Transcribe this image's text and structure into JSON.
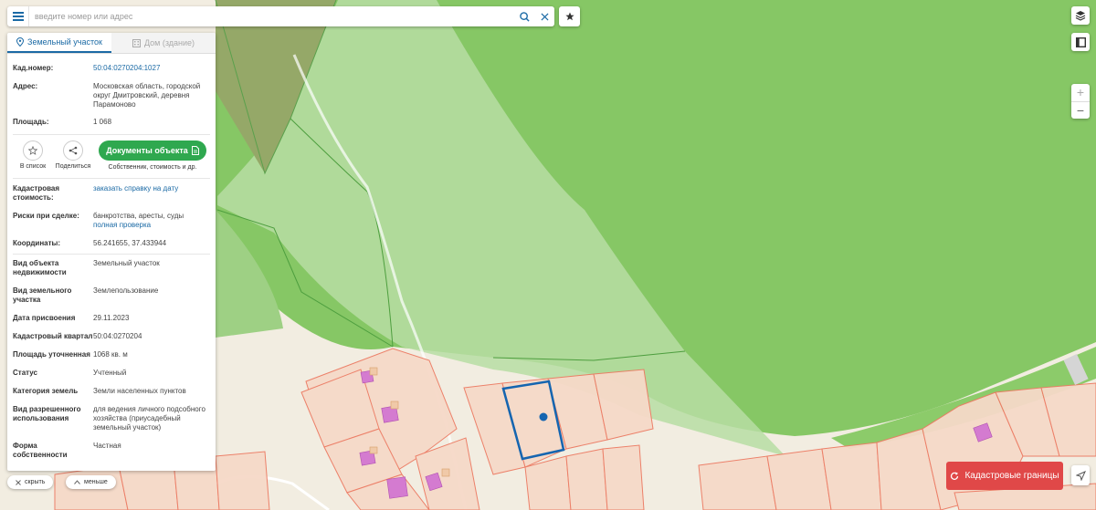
{
  "search": {
    "placeholder": "введите номер или адрес"
  },
  "tabs": [
    {
      "label": "Земельный участок",
      "active": true
    },
    {
      "label": "Дом (здание)",
      "active": false
    }
  ],
  "info": {
    "cad_number_label": "Кад.номер:",
    "cad_number": "50:04:0270204:1027",
    "address_label": "Адрес:",
    "address": "Московская область, городской округ Дмитровский, деревня Парамоново",
    "area_label": "Площадь:",
    "area": "1 068"
  },
  "actions": {
    "favorite_label": "В список",
    "share_label": "Поделиться",
    "docs_label": "Документы объекта",
    "docs_sub": "Собственник, стоимость и др."
  },
  "details": [
    {
      "label": "Кадастровая стоимость:",
      "value": "заказать справку на дату",
      "link": true
    },
    {
      "label": "Риски при сделке:",
      "value": "банкротства, аресты, суды",
      "extra_link": "полная проверка"
    },
    {
      "label": "Координаты:",
      "value": "56.241655, 37.433944"
    },
    {
      "label": "Вид объекта недвижимости",
      "value": "Земельный участок"
    },
    {
      "label": "Вид земельного участка",
      "value": "Землепользование"
    },
    {
      "label": "Дата присвоения",
      "value": "29.11.2023"
    },
    {
      "label": "Кадастровый квартал",
      "value": "50:04:0270204"
    },
    {
      "label": "Площадь уточненная",
      "value": "1068 кв. м"
    },
    {
      "label": "Статус",
      "value": "Учтенный"
    },
    {
      "label": "Категория земель",
      "value": "Земли населенных пунктов"
    },
    {
      "label": "Вид разрешенного использования",
      "value": "для ведения личного подсобного хозяйства (приусадебный земельный участок)"
    },
    {
      "label": "Форма собственности",
      "value": "Частная"
    }
  ],
  "bottom": {
    "hide_label": "скрыть",
    "less_label": "меньше"
  },
  "map_controls": {
    "cadastral_button": "Кадастровые границы"
  },
  "colors": {
    "accent": "#1b6aa5",
    "docs_green": "#2fa84f",
    "cadastral_red": "#e04848",
    "forest": "#86c765",
    "parcel_fill": "#f6d9c8",
    "parcel_stroke": "#ec7b63",
    "selection": "#1565b0",
    "building": "#d47bd0"
  },
  "icons": [
    "menu-icon",
    "search-icon",
    "close-icon",
    "star-icon",
    "layers-icon",
    "frame-icon",
    "location-pin-icon",
    "building-icon",
    "share-icon",
    "document-icon",
    "refresh-icon",
    "navigate-icon",
    "chevron-up-icon"
  ]
}
